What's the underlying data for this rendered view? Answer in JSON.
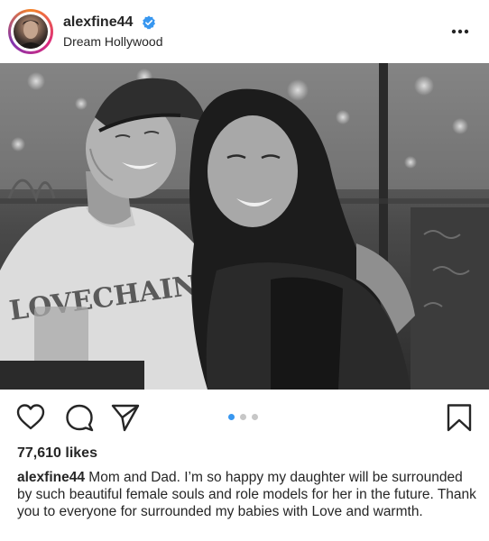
{
  "post": {
    "username": "alexfine44",
    "location": "Dream Hollywood",
    "verified": true,
    "photo": {
      "printed_text": "LOVECHAIN"
    },
    "carousel": {
      "count": 3,
      "active_index": 0,
      "active_color": "#3897f0",
      "inactive_color": "#c7c7c7"
    },
    "likes": "77,610 likes",
    "caption": {
      "username": "alexfine44",
      "text": "Mom and Dad. I’m so happy my daughter will be surrounded by such beautiful female souls and role models for her in the future. Thank you to everyone for surrounded my babies with Love and warmth."
    }
  },
  "icons": {
    "verified": "verified-badge-icon",
    "more": "more-options-icon",
    "like": "heart-icon",
    "comment": "comment-bubble-icon",
    "share": "paper-plane-icon",
    "save": "bookmark-icon"
  },
  "colors": {
    "text": "#262626",
    "verified_blue": "#3897f0",
    "background": "#ffffff"
  }
}
